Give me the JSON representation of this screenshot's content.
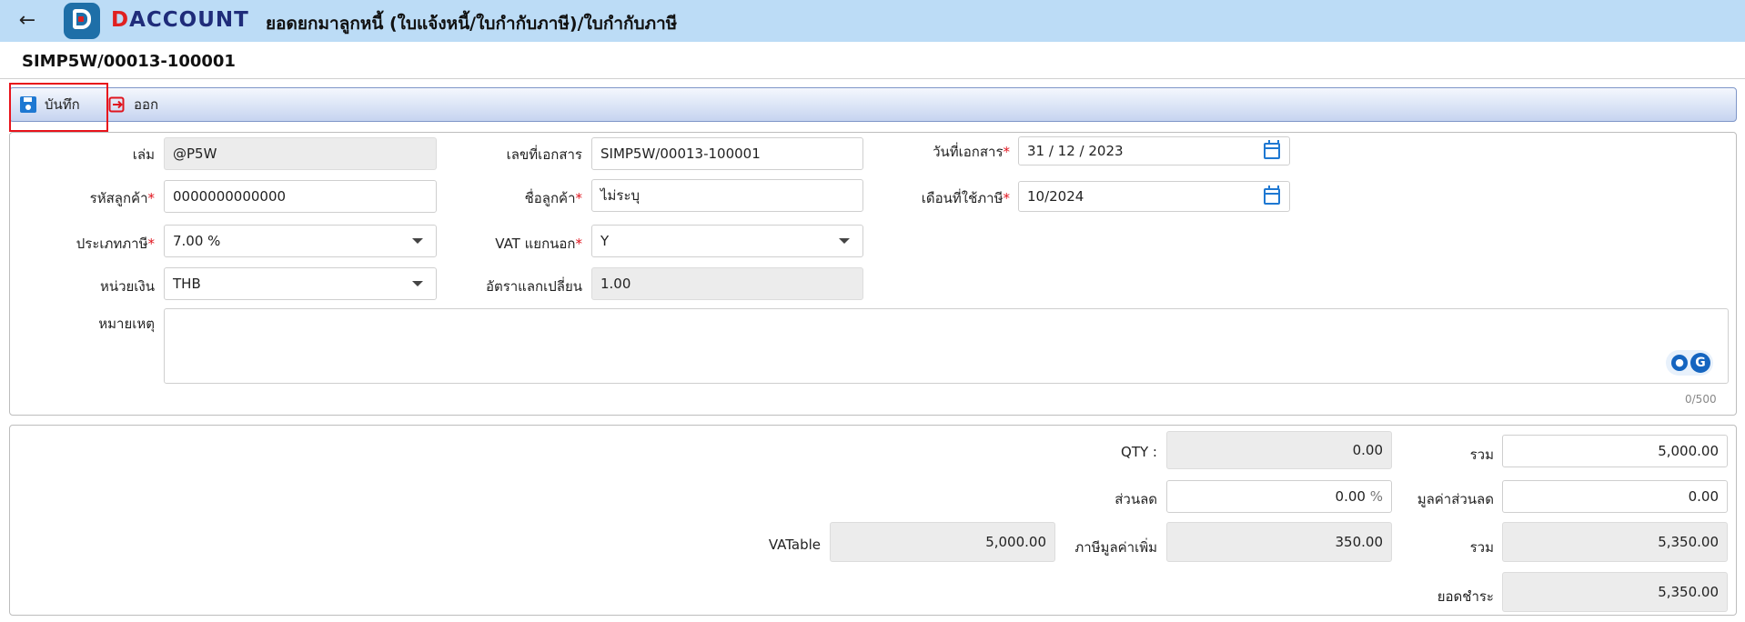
{
  "app": {
    "logo_prefix": "D",
    "logo_text": "ACCOUNT",
    "title": "ยอดยกมาลูกหนี้ (ใบแจ้งหนี้/ใบกำกับภาษี)/ใบกำกับภาษี"
  },
  "document_number": "SIMP5W/00013-100001",
  "toolbar": {
    "save_label": "บันทึก",
    "exit_label": "ออก"
  },
  "form": {
    "book": {
      "label": "เล่ม",
      "value": "@P5W"
    },
    "doc_no": {
      "label": "เลขที่เอกสาร",
      "value": "SIMP5W/00013-100001"
    },
    "doc_date": {
      "label": "วันที่เอกสาร",
      "value": "31 / 12 /  2023"
    },
    "customer_code": {
      "label": "รหัสลูกค้า",
      "value": "0000000000000"
    },
    "customer_name": {
      "label": "ชื่อลูกค้า",
      "value": "ไม่ระบุ"
    },
    "tax_month": {
      "label": "เดือนที่ใช้ภาษี",
      "value": "10/2024"
    },
    "tax_type": {
      "label": "ประเภทภาษี",
      "value": "7.00 %"
    },
    "vat_separate": {
      "label": "VAT แยกนอก",
      "value": "Y"
    },
    "currency": {
      "label": "หน่วยเงิน",
      "value": "THB"
    },
    "exchange_rate": {
      "label": "อัตราแลกเปลี่ยน",
      "value": "1.00"
    },
    "remark": {
      "label": "หมายเหตุ",
      "value": "",
      "counter": "0/500"
    }
  },
  "summary": {
    "qty": {
      "label": "QTY :",
      "value": "0.00"
    },
    "total": {
      "label": "รวม",
      "value": "5,000.00"
    },
    "discount": {
      "label": "ส่วนลด",
      "value": "0.00",
      "unit": "%"
    },
    "discount_value": {
      "label": "มูลค่าส่วนลด",
      "value": "0.00"
    },
    "vatable": {
      "label": "VATable",
      "value": "5,000.00"
    },
    "vat": {
      "label": "ภาษีมูลค่าเพิ่ม",
      "value": "350.00"
    },
    "grand_total": {
      "label": "รวม",
      "value": "5,350.00"
    },
    "payment": {
      "label": "ยอดชำระ",
      "value": "5,350.00"
    }
  },
  "colors": {
    "topbar": "#bcdcf6",
    "accent": "#1e78d2",
    "highlight": "#e8131b",
    "required": "#e0141e"
  }
}
